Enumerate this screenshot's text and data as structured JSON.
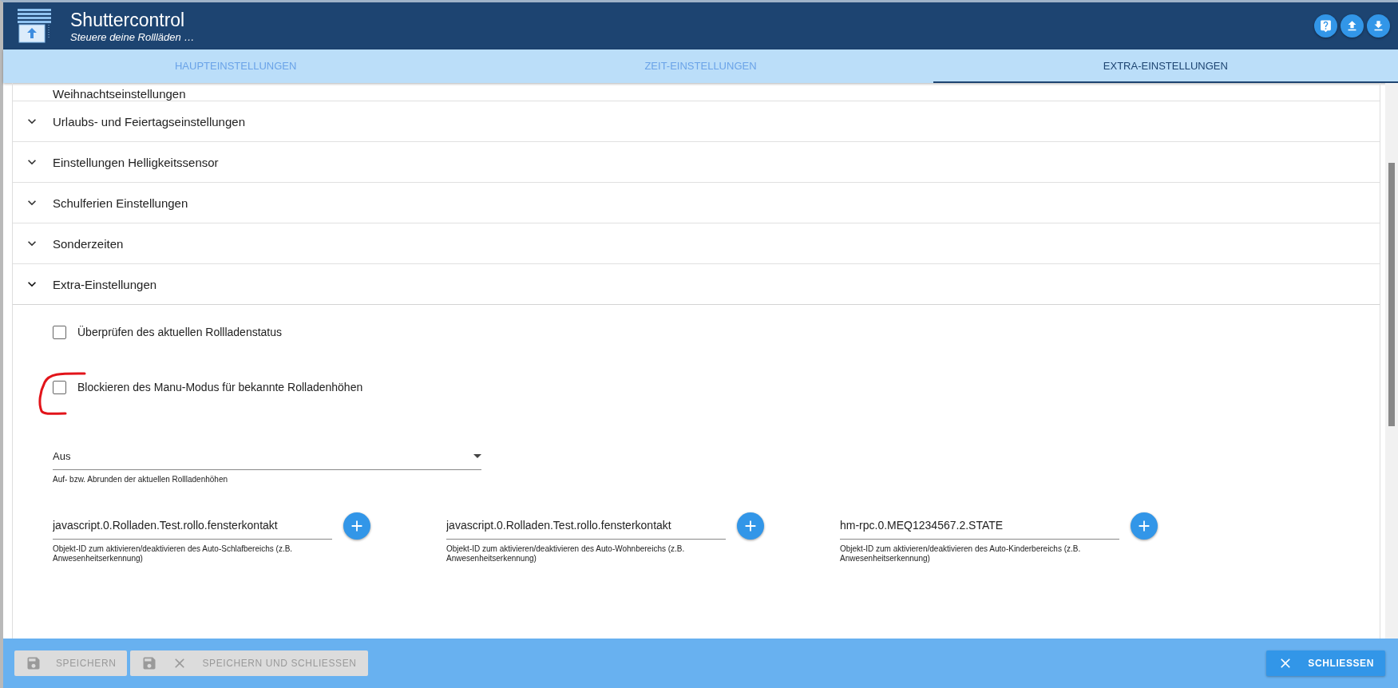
{
  "app": {
    "title": "Shuttercontrol",
    "subtitle": "Steuere deine Rollläden …"
  },
  "header_actions": [
    {
      "kind": "help"
    },
    {
      "kind": "upload"
    },
    {
      "kind": "download"
    }
  ],
  "tabs": [
    {
      "label": "HAUPTEINSTELLUNGEN",
      "selected": false
    },
    {
      "label": "ZEIT-EINSTELLUNGEN",
      "selected": false
    },
    {
      "label": "EXTRA-EINSTELLUNGEN",
      "selected": true
    }
  ],
  "sections": [
    {
      "title": "Weihnachtseinstellungen",
      "expanded": false
    },
    {
      "title": "Urlaubs- und Feiertagseinstellungen",
      "expanded": false
    },
    {
      "title": "Einstellungen Helligkeitssensor",
      "expanded": false
    },
    {
      "title": "Schulferien Einstellungen",
      "expanded": false
    },
    {
      "title": "Sonderzeiten",
      "expanded": false
    },
    {
      "title": "Extra-Einstellungen",
      "expanded": true
    }
  ],
  "extra": {
    "checkboxes": [
      {
        "label": "Überprüfen des aktuellen Rollladenstatus",
        "checked": false
      },
      {
        "label": "Blockieren des Manu-Modus für bekannte Rolladenhöhen",
        "checked": false
      }
    ],
    "select": {
      "value": "Aus",
      "helper": "Auf- bzw. Abrunden der aktuellen Rollladenhöhen"
    },
    "object_fields": [
      {
        "value": "javascript.0.Rolladen.Test.rollo.fensterkontakt",
        "helper": "Objekt-ID zum aktivieren/deaktivieren des Auto-Schlafbereichs (z.B. Anwesenheitserkennung)"
      },
      {
        "value": "javascript.0.Rolladen.Test.rollo.fensterkontakt",
        "helper": "Objekt-ID zum aktivieren/deaktivieren des Auto-Wohnbereichs (z.B. Anwesenheitserkennung)"
      },
      {
        "value": "hm-rpc.0.MEQ1234567.2.STATE",
        "helper": "Objekt-ID zum aktivieren/deaktivieren des Auto-Kinderbereichs (z.B. Anwesenheitserkennung)"
      }
    ]
  },
  "footer": {
    "buttons": [
      {
        "label": "SPEICHERN",
        "kind": "save",
        "disabled": true
      },
      {
        "label": "SPEICHERN UND SCHLIESSEN",
        "kind": "save_close",
        "disabled": true
      },
      {
        "label": "SCHLIESSEN",
        "kind": "close",
        "disabled": false
      }
    ]
  }
}
